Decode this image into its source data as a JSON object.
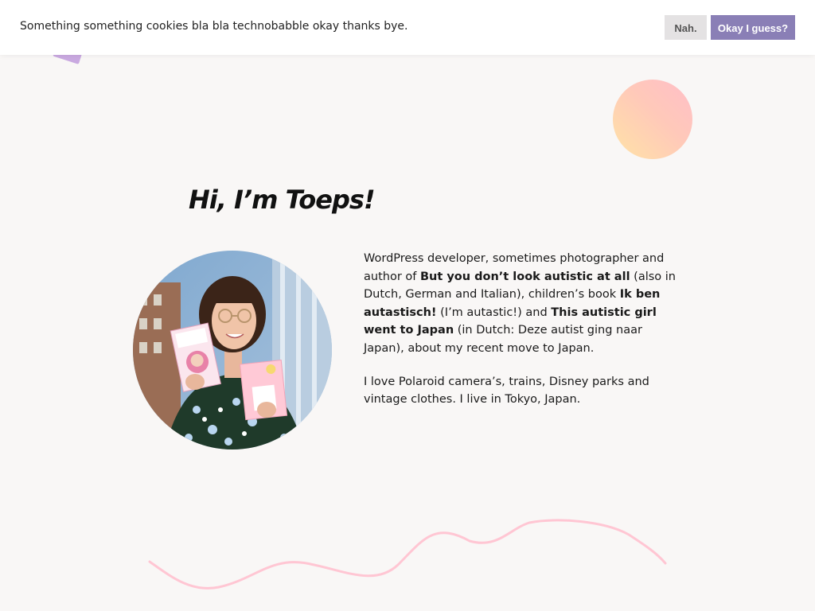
{
  "cookie_banner": {
    "message": "Something something cookies bla bla technobabble okay thanks bye.",
    "decline_label": "Nah.",
    "accept_label": "Okay I guess?"
  },
  "hero": {
    "title": "Hi, I’m Toeps!"
  },
  "bio": {
    "p1": {
      "t1": "WordPress developer, sometimes photographer and author of ",
      "b1": "But you don’t look autistic at all",
      "t2": " (also in Dutch, German and Italian), children’s book ",
      "b2": "Ik ben autastisch!",
      "t3": " (I’m autastic!) and ",
      "b3": "This autistic girl went to Japan",
      "t4": " (in Dutch: Deze autist ging naar Japan), about my recent move to Japan."
    },
    "p2": "I love Polaroid camera’s, trains, Disney parks and vintage clothes. I live in Tokyo, Japan."
  },
  "colors": {
    "accent": "#8a7fb6",
    "squiggle": "#ffc6d3",
    "circle_pink": "#ffbec8",
    "circle_yellow": "#ffe3a6",
    "background": "#f9f7f6"
  }
}
